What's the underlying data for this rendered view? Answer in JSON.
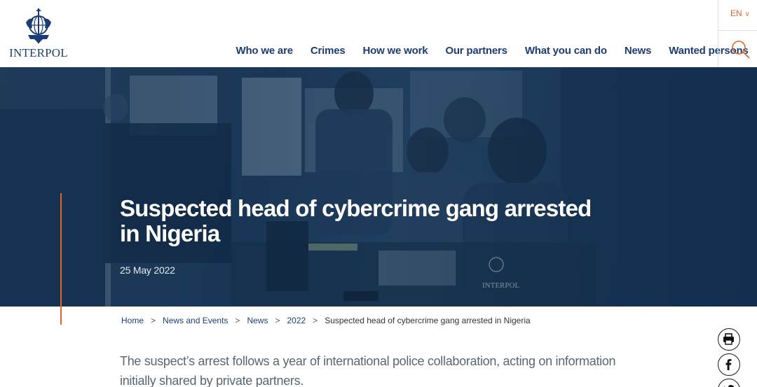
{
  "header": {
    "logo_text": "INTERPOL",
    "nav": [
      {
        "label": "Who we are"
      },
      {
        "label": "Crimes"
      },
      {
        "label": "How we work"
      },
      {
        "label": "Our partners"
      },
      {
        "label": "What you can do"
      },
      {
        "label": "News"
      },
      {
        "label": "Wanted persons"
      }
    ],
    "language": "EN",
    "search_icon": "search-icon"
  },
  "hero": {
    "title_line1": "Suspected head of cybercrime gang arrested",
    "title_line2": "in Nigeria",
    "date": "25 May 2022"
  },
  "breadcrumb": [
    {
      "label": "Home"
    },
    {
      "label": "News and Events"
    },
    {
      "label": "News"
    },
    {
      "label": "2022"
    },
    {
      "label": "Suspected head of cybercrime gang arrested in Nigeria"
    }
  ],
  "breadcrumb_separator": ">",
  "article": {
    "lead": "The suspect’s arrest follows a year of international police collaboration, acting on information initially shared by private partners."
  },
  "share": {
    "icons": [
      "print-icon",
      "facebook-icon",
      "twitter-icon"
    ]
  },
  "colors": {
    "brand_blue": "#1c3d73",
    "accent_orange": "#e0632b"
  }
}
